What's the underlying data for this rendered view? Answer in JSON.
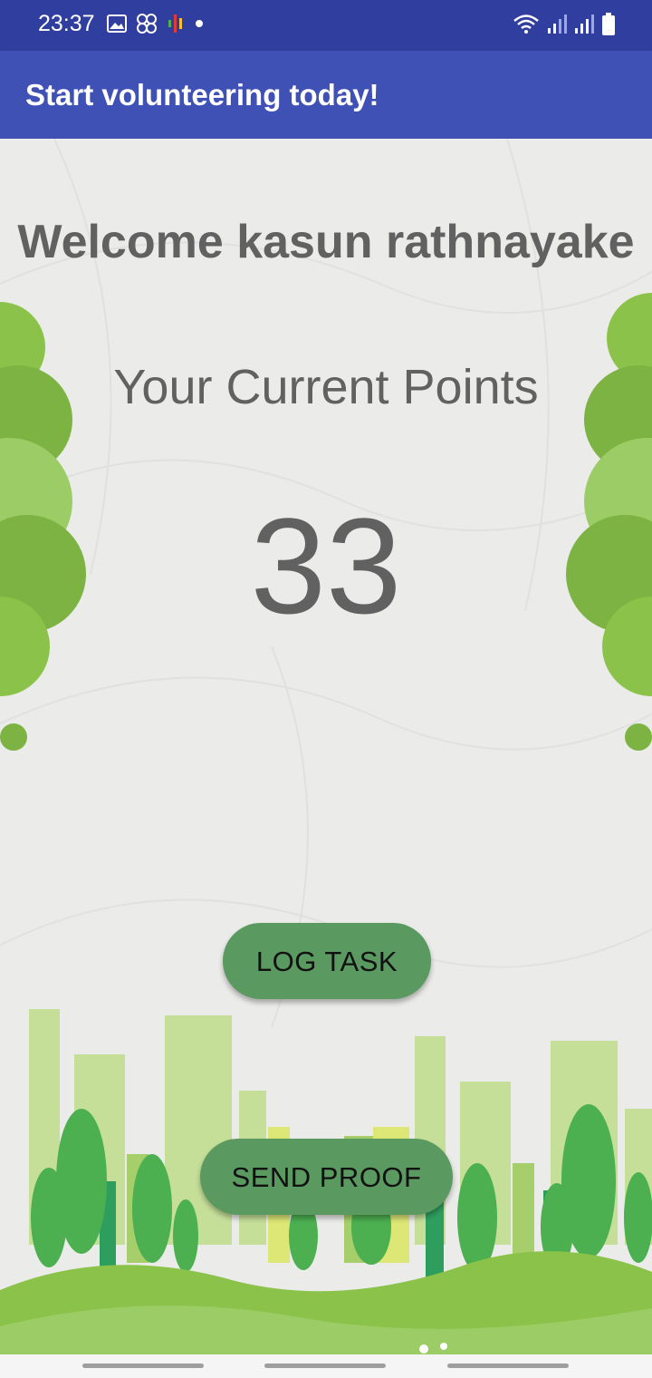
{
  "status_bar": {
    "time": "23:37",
    "left_icons": [
      "image-icon",
      "link-icon",
      "podcast-icon",
      "dot-icon"
    ],
    "right_icons": [
      "wifi-icon",
      "signal-icon",
      "signal-icon",
      "battery-icon"
    ]
  },
  "app_bar": {
    "title": "Start volunteering today!"
  },
  "main": {
    "welcome": "Welcome kasun rathnayake",
    "points_label": "Your Current Points",
    "points_value": "33",
    "log_task_label": "LOG TASK",
    "send_proof_label": "SEND PROOF"
  },
  "colors": {
    "status_bar": "#303f9f",
    "app_bar": "#3f51b5",
    "button": "#5a9960",
    "text": "#616161",
    "background": "#ebebe9"
  }
}
